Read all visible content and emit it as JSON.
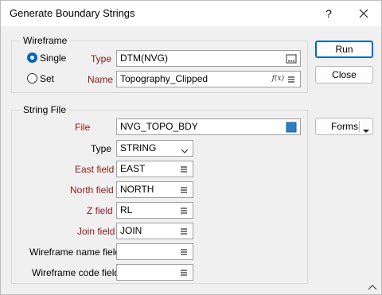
{
  "window": {
    "title": "Generate Boundary Strings",
    "help_label": "?"
  },
  "wireframe": {
    "group_title": "Wireframe",
    "single_label": "Single",
    "set_label": "Set",
    "selected": "Single",
    "type_label": "Type",
    "type_value": "DTM(NVG)",
    "name_label": "Name",
    "name_value": "Topography_Clipped",
    "fx_label": "f(x)"
  },
  "actions": {
    "run_label": "Run",
    "close_label": "Close",
    "forms_label": "Forms"
  },
  "string_file": {
    "group_title": "String File",
    "file_label": "File",
    "file_value": "NVG_TOPO_BDY",
    "type_label": "Type",
    "type_value": "STRING",
    "east_label": "East field",
    "east_value": "EAST",
    "north_label": "North field",
    "north_value": "NORTH",
    "z_label": "Z field",
    "z_value": "RL",
    "join_label": "Join field",
    "join_value": "JOIN",
    "wf_name_label": "Wireframe name field",
    "wf_name_value": "",
    "wf_code_label": "Wireframe code field",
    "wf_code_value": ""
  },
  "colors": {
    "required_label": "#8b1a1a",
    "accent": "#0067c0",
    "file_icon": "#2e7fc1"
  }
}
